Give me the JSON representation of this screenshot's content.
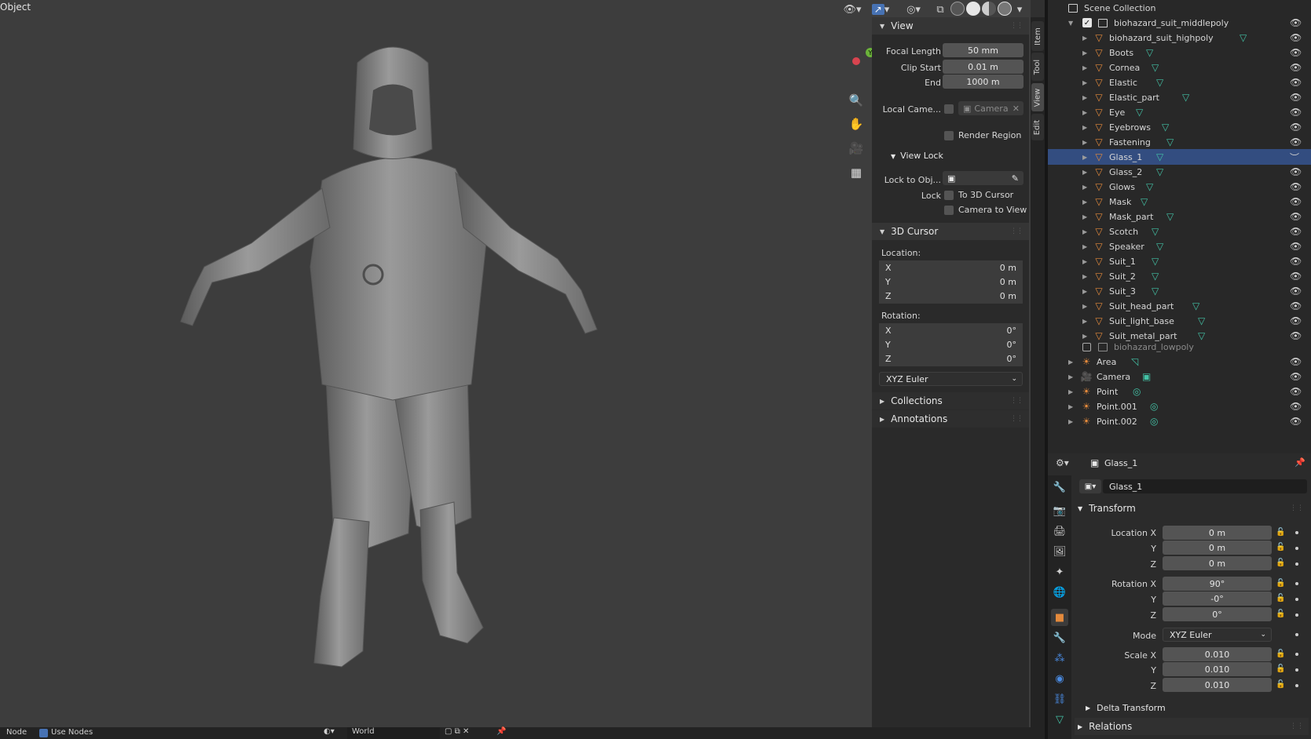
{
  "viewport": {
    "mode_label": "Object"
  },
  "npanel": {
    "tabs": [
      "Item",
      "Tool",
      "View",
      "Edit"
    ],
    "active_tab": "View",
    "view_section": {
      "title": "View",
      "focal_length_label": "Focal Length",
      "focal_length": "50 mm",
      "clip_start_label": "Clip Start",
      "clip_start": "0.01 m",
      "end_label": "End",
      "end": "1000 m",
      "local_camera_label": "Local Came...",
      "local_camera_value": "Camera",
      "render_region_label": "Render Region"
    },
    "view_lock": {
      "title": "View Lock",
      "lock_to_obj_label": "Lock to Obj...",
      "lock_label": "Lock",
      "to_3d_cursor": "To 3D Cursor",
      "camera_to_view": "Camera to View"
    },
    "cursor": {
      "title": "3D Cursor",
      "location_label": "Location:",
      "loc": [
        {
          "axis": "X",
          "value": "0 m"
        },
        {
          "axis": "Y",
          "value": "0 m"
        },
        {
          "axis": "Z",
          "value": "0 m"
        }
      ],
      "rotation_label": "Rotation:",
      "rot": [
        {
          "axis": "X",
          "value": "0°"
        },
        {
          "axis": "Y",
          "value": "0°"
        },
        {
          "axis": "Z",
          "value": "0°"
        }
      ],
      "rotation_mode": "XYZ Euler"
    },
    "collections_label": "Collections",
    "annotations_label": "Annotations"
  },
  "outliner": {
    "root": "Scene Collection",
    "collection_middle": "biohazard_suit_middlepoly",
    "items": [
      "biohazard_suit_highpoly",
      "Boots",
      "Cornea",
      "Elastic",
      "Elastic_part",
      "Eye",
      "Eyebrows",
      "Fastening",
      "Glass_1",
      "Glass_2",
      "Glows",
      "Mask",
      "Mask_part",
      "Scotch",
      "Speaker",
      "Suit_1",
      "Suit_2",
      "Suit_3",
      "Suit_head_part",
      "Suit_light_base",
      "Suit_metal_part"
    ],
    "selected": "Glass_1",
    "collection_low": "biohazard_lowpoly",
    "extras": [
      "Area",
      "Camera",
      "Point",
      "Point.001",
      "Point.002"
    ]
  },
  "properties": {
    "object_name": "Glass_1",
    "name_field": "Glass_1",
    "transform_title": "Transform",
    "location_label": "Location X",
    "location": [
      "0 m",
      "0 m",
      "0 m"
    ],
    "rotation_label": "Rotation X",
    "rotation": [
      "90°",
      "-0°",
      "0°"
    ],
    "mode_label": "Mode",
    "mode_value": "XYZ Euler",
    "scale_label": "Scale X",
    "scale": [
      "0.010",
      "0.010",
      "0.010"
    ],
    "axis_y": "Y",
    "axis_z": "Z",
    "delta_transform": "Delta Transform",
    "relations": "Relations"
  },
  "bottom_bar": {
    "node_label": "Node",
    "use_nodes": "Use Nodes",
    "world": "World"
  },
  "colors": {
    "accent": "#4772b3",
    "selection": "#334d80",
    "mesh_icon": "#e48a3c",
    "data_icon": "#43c2a6"
  }
}
